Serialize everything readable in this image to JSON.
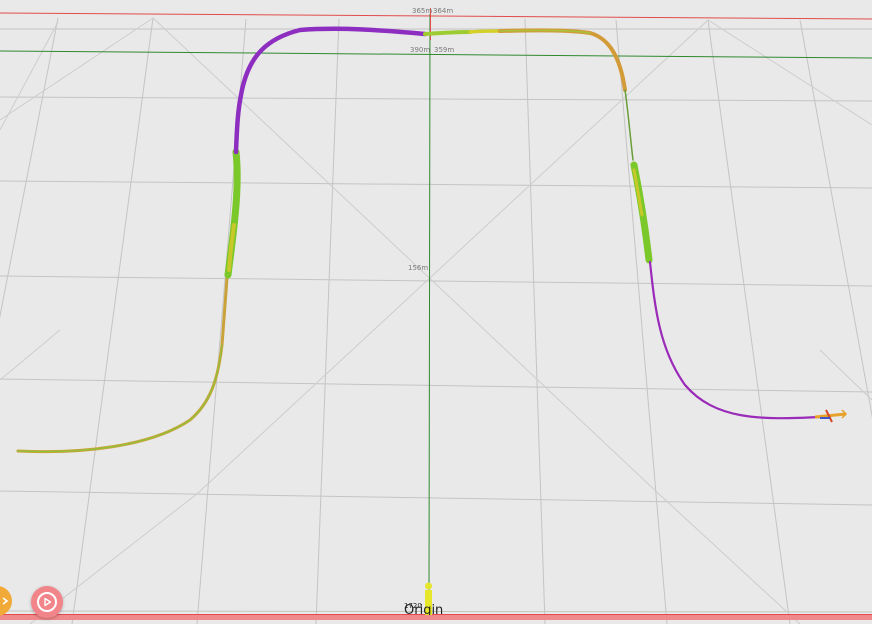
{
  "scene": {
    "axis_labels": {
      "top_left": "365m",
      "top_right": "364m",
      "upper_left": "390m",
      "upper_right": "359m",
      "center": "156m",
      "origin_value": "1720"
    },
    "origin_label": "Origin",
    "colors": {
      "background": "#e9e9e9",
      "grid": "#c4c4c4",
      "x_axis": "#e24c4c",
      "y_axis": "#2f8a2f",
      "track_purple": "#8e2ec0",
      "track_green": "#7ac82a",
      "track_orange": "#d39a38",
      "track_yellow": "#c8c82a",
      "origin_marker": "#e6e62a"
    }
  },
  "controls": {
    "play_icon": "play-icon",
    "secondary_icon": "chevron-right-icon"
  }
}
